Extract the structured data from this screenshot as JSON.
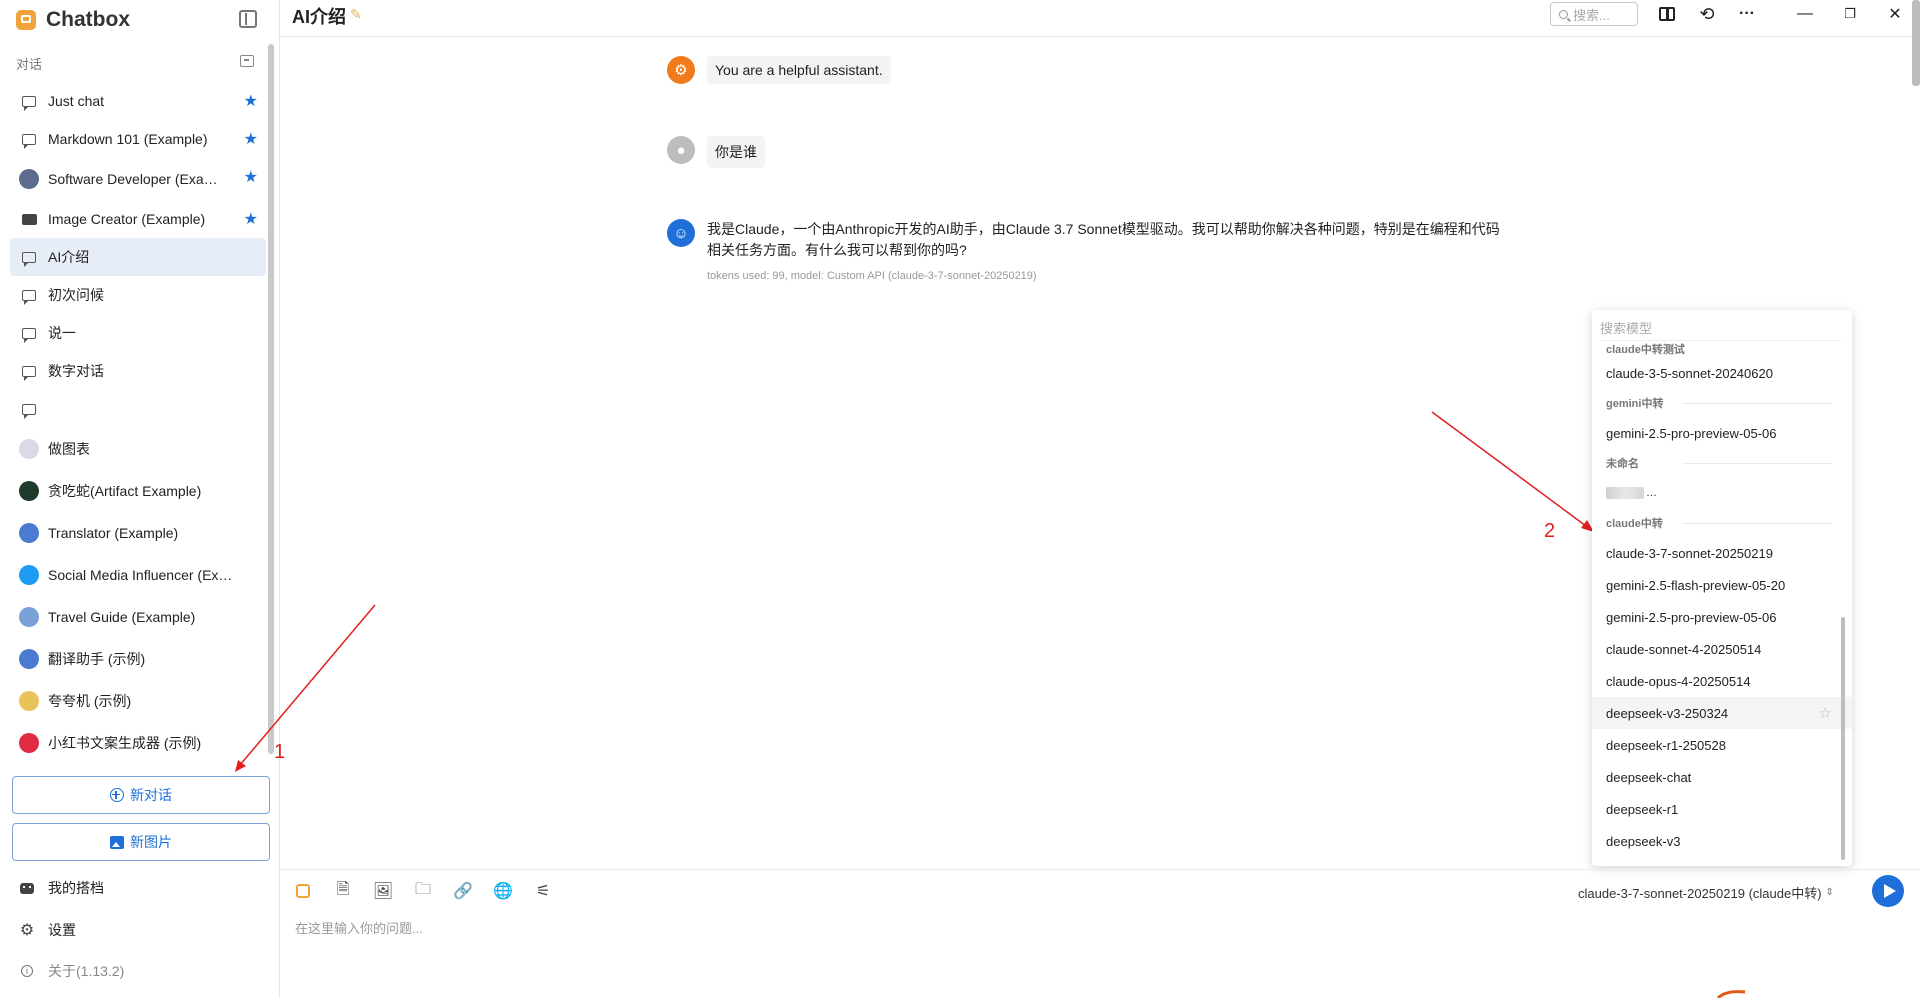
{
  "app": {
    "title": "Chatbox"
  },
  "sidebar": {
    "section_label": "对话",
    "conversations": [
      {
        "label": "Just chat",
        "icon": "chat-bubble-icon",
        "starred": true
      },
      {
        "label": "Markdown 101 (Example)",
        "icon": "chat-bubble-icon",
        "starred": true
      },
      {
        "label": "Software Developer (Exa…",
        "icon": "developer-avatar-icon",
        "starred": true
      },
      {
        "label": "Image Creator (Example)",
        "icon": "image-icon",
        "starred": true
      },
      {
        "label": "AI介绍",
        "icon": "chat-bubble-icon",
        "starred": false,
        "active": true
      },
      {
        "label": "初次问候",
        "icon": "chat-bubble-icon",
        "starred": false
      },
      {
        "label": "说一",
        "icon": "chat-bubble-icon",
        "starred": false
      },
      {
        "label": "数字对话",
        "icon": "chat-bubble-icon",
        "starred": false
      },
      {
        "label": "",
        "icon": "chat-bubble-icon",
        "starred": false
      },
      {
        "label": "做图表",
        "icon": "chart-avatar-icon",
        "starred": false
      },
      {
        "label": "贪吃蛇(Artifact Example)",
        "icon": "snake-avatar-icon",
        "starred": false
      },
      {
        "label": "Translator (Example)",
        "icon": "translator-avatar-icon",
        "starred": false
      },
      {
        "label": "Social Media Influencer (Example)",
        "icon": "twitter-avatar-icon",
        "starred": false
      },
      {
        "label": "Travel Guide (Example)",
        "icon": "globe-avatar-icon",
        "starred": false
      },
      {
        "label": "翻译助手 (示例)",
        "icon": "translator-avatar-icon",
        "starred": false
      },
      {
        "label": "夸夸机 (示例)",
        "icon": "flower-avatar-icon",
        "starred": false
      },
      {
        "label": "小红书文案生成器 (示例)",
        "icon": "xiaohongshu-avatar-icon",
        "starred": false
      }
    ],
    "new_chat_label": "新对话",
    "new_image_label": "新图片",
    "footer": {
      "copilots_label": "我的搭档",
      "settings_label": "设置",
      "about_label": "关于(1.13.2)"
    }
  },
  "header": {
    "page_title": "AI介绍",
    "search_placeholder": "搜索..."
  },
  "messages": {
    "system": "You are a helpful assistant.",
    "user": "你是谁",
    "assistant_line1": "我是Claude，一个由Anthropic开发的AI助手，由Claude 3.7 Sonnet模型驱动。我可以帮助你解决各种问题，特别是在编程和代码",
    "assistant_line2": "相关任务方面。有什么我可以帮到你的吗?",
    "meta": "tokens used: 99, model: Custom API (claude-3-7-sonnet-20250219)"
  },
  "model_picker": {
    "search_placeholder": "搜索模型",
    "groups": [
      {
        "label": "claude中转测试",
        "models": [
          "claude-3-5-sonnet-20240620"
        ]
      },
      {
        "label": "gemini中转",
        "models": [
          "gemini-2.5-pro-preview-05-06"
        ]
      },
      {
        "label": "未命名",
        "models": [
          "…"
        ]
      },
      {
        "label": "claude中转",
        "models": [
          "claude-3-7-sonnet-20250219",
          "gemini-2.5-flash-preview-05-20",
          "gemini-2.5-pro-preview-05-06",
          "claude-sonnet-4-20250514",
          "claude-opus-4-20250514",
          "deepseek-v3-250324",
          "deepseek-r1-250528",
          "deepseek-chat",
          "deepseek-r1",
          "deepseek-v3"
        ]
      }
    ]
  },
  "input": {
    "placeholder": "在这里输入你的问题...",
    "selected_model": "claude-3-7-sonnet-20250219 (claude中转)"
  },
  "annotations": {
    "marker1": "1",
    "marker2": "2"
  },
  "colors": {
    "accent": "#1e6fd9",
    "annotation": "#e02020",
    "system_avatar": "#f07b1c",
    "assistant_avatar": "#1e6fd9",
    "user_avatar": "#bdbdbd"
  }
}
